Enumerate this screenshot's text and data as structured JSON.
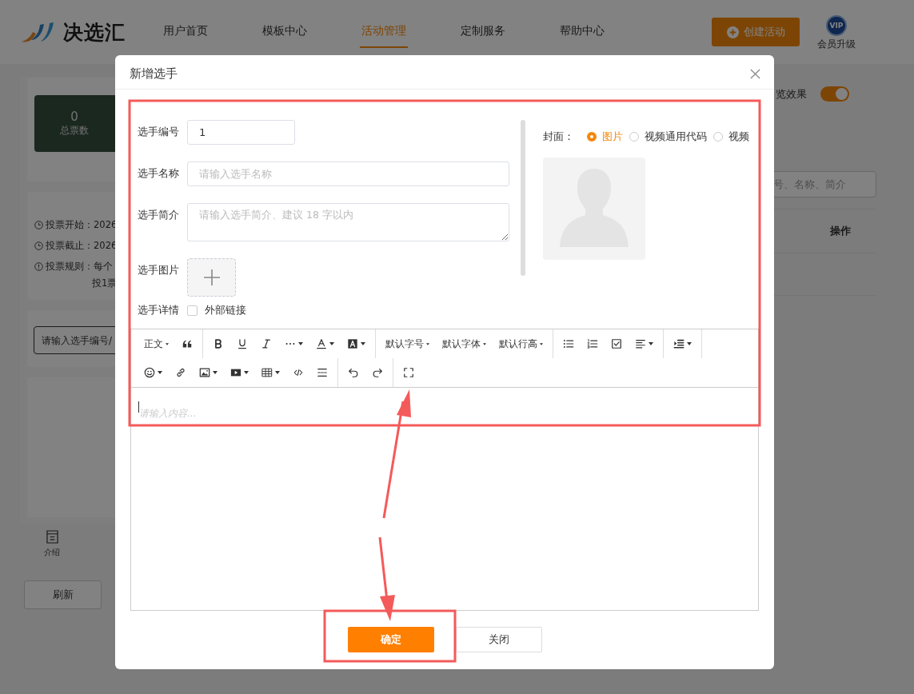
{
  "header": {
    "logo": "决选汇",
    "nav": [
      {
        "label": "用户首页",
        "selected": false
      },
      {
        "label": "模板中心",
        "selected": false
      },
      {
        "label": "活动管理",
        "selected": true
      },
      {
        "label": "定制服务",
        "selected": false
      },
      {
        "label": "帮助中心",
        "selected": false
      }
    ],
    "create_button": "创建活动",
    "vip_badge": "VIP",
    "vip_label": "会员升级"
  },
  "sidebar": {
    "stats": {
      "value": "0",
      "label": "总票数"
    },
    "info": [
      {
        "kind": "clock",
        "text": "投票开始：2026"
      },
      {
        "kind": "clock",
        "text": "投票截止：2026"
      },
      {
        "kind": "alert",
        "text": "投票规则：每个",
        "continuation": "投1票"
      }
    ],
    "search": {
      "placeholder": "请输入选手编号/"
    },
    "tabs": [
      {
        "label": "介绍"
      }
    ],
    "refresh_button": "刷新"
  },
  "right_panel": {
    "preview_label": "览效果",
    "preview_on": true,
    "search": {
      "placeholder": "号、名称、简介"
    },
    "columns": [
      "操作"
    ]
  },
  "dialog": {
    "title": "新增选手",
    "fields": [
      {
        "kind": "short-input",
        "label": "选手编号",
        "value": "1"
      },
      {
        "kind": "input",
        "label": "选手名称",
        "placeholder": "请输入选手名称"
      },
      {
        "kind": "textarea",
        "label": "选手简介",
        "placeholder": "请输入选手简介、建议 18 字以内"
      },
      {
        "kind": "upload",
        "label": "选手图片"
      },
      {
        "kind": "checkbox",
        "label": "选手详情",
        "option": "外部链接",
        "checked": false
      }
    ],
    "cover": {
      "label": "封面：",
      "options": [
        {
          "label": "图片",
          "selected": true
        },
        {
          "label": "视频通用代码",
          "selected": false
        },
        {
          "label": "视频",
          "selected": false
        }
      ]
    },
    "editor": {
      "toolbar": [
        [
          {
            "kind": "dropdown",
            "label": "正文"
          },
          {
            "kind": "quote"
          }
        ],
        [
          {
            "kind": "bold"
          },
          {
            "kind": "underline"
          },
          {
            "kind": "italic"
          },
          {
            "kind": "more"
          },
          {
            "kind": "font-color"
          },
          {
            "kind": "bg-color"
          }
        ],
        [
          {
            "kind": "dropdown",
            "label": "默认字号"
          },
          {
            "kind": "dropdown",
            "label": "默认字体"
          },
          {
            "kind": "dropdown",
            "label": "默认行高"
          }
        ],
        [
          {
            "kind": "bullet-list"
          },
          {
            "kind": "numbered-list"
          },
          {
            "kind": "checklist"
          },
          {
            "kind": "align"
          }
        ],
        [
          {
            "kind": "indent"
          }
        ],
        [
          {
            "kind": "emoji"
          },
          {
            "kind": "link"
          },
          {
            "kind": "image"
          },
          {
            "kind": "video"
          },
          {
            "kind": "table"
          },
          {
            "kind": "code"
          },
          {
            "kind": "divider"
          }
        ],
        [
          {
            "kind": "undo"
          },
          {
            "kind": "redo"
          }
        ],
        [
          {
            "kind": "fullscreen"
          }
        ]
      ],
      "placeholder": "请输入内容..."
    },
    "buttons": [
      {
        "kind": "primary",
        "label": "确定"
      },
      {
        "kind": "default",
        "label": "关闭"
      }
    ]
  }
}
